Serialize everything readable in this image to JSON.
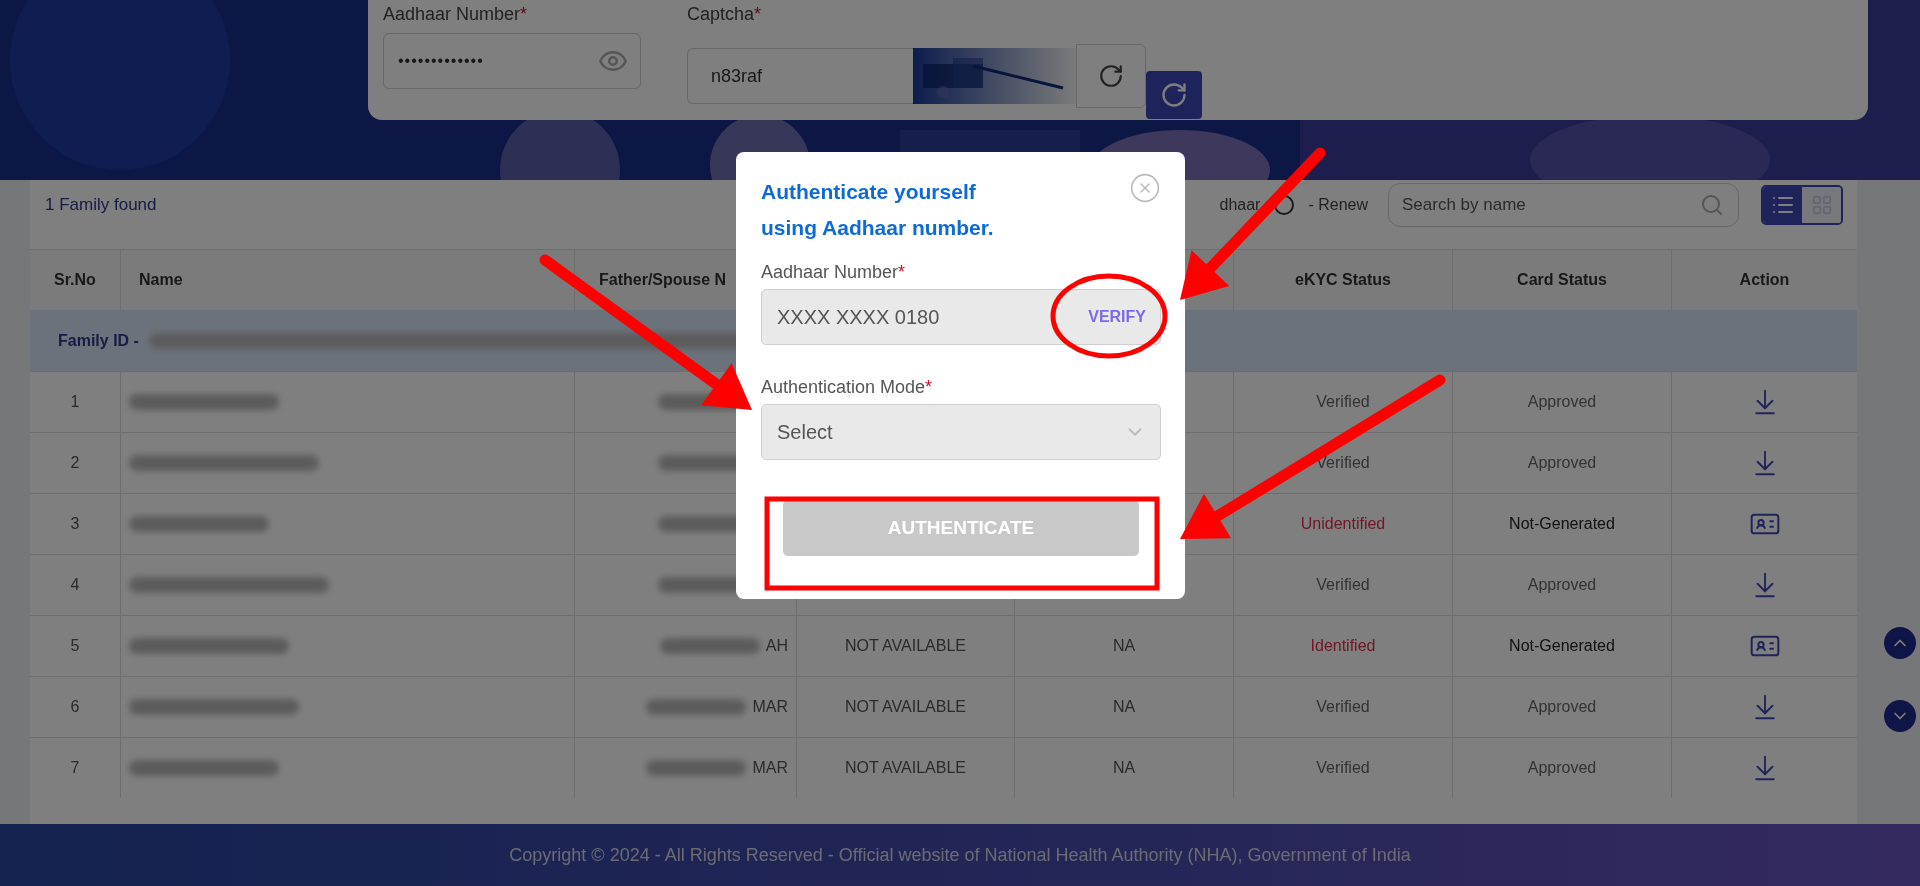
{
  "search_form": {
    "fields": [
      {
        "kind": "password",
        "label": "Aadhaar Number",
        "required_mark": "*",
        "value": "•••••••••••••"
      },
      {
        "kind": "captcha",
        "label": "Captcha",
        "required_mark": "*",
        "value": "n83raf"
      }
    ]
  },
  "results": {
    "summary": "1 Family found",
    "legend": [
      "dhaar",
      "- Renew"
    ],
    "search": {
      "placeholder": "Search by name"
    },
    "view_modes": [
      {
        "kind": "list",
        "selected": true
      },
      {
        "kind": "grid",
        "selected": false
      }
    ],
    "table": {
      "columns": [
        "Sr.No",
        "Name",
        "Father/Spouse N",
        "eKYC Status",
        "Card Status",
        "Action"
      ],
      "group": {
        "label": "Family ID -"
      },
      "rows": [
        {
          "sr": "1",
          "ekyc": {
            "text": "Verified",
            "verified": true
          },
          "card": {
            "text": "Approved",
            "generated": true
          },
          "action": {
            "kind": "download"
          }
        },
        {
          "sr": "2",
          "ekyc": {
            "text": "Verified",
            "verified": true
          },
          "card": {
            "text": "Approved",
            "generated": true
          },
          "action": {
            "kind": "download"
          }
        },
        {
          "sr": "3",
          "ekyc": {
            "text": "Unidentified",
            "verified": false
          },
          "card": {
            "text": "Not-Generated",
            "generated": false
          },
          "action": {
            "kind": "card"
          }
        },
        {
          "sr": "4",
          "ekyc": {
            "text": "Verified",
            "verified": true
          },
          "card": {
            "text": "Approved",
            "generated": true
          },
          "action": {
            "kind": "download"
          }
        },
        {
          "sr": "5",
          "father_fragment": "AH",
          "column_4": "NOT AVAILABLE",
          "column_5": "NA",
          "ekyc": {
            "text": "Identified",
            "verified": false
          },
          "card": {
            "text": "Not-Generated",
            "generated": false
          },
          "action": {
            "kind": "card"
          }
        },
        {
          "sr": "6",
          "father_fragment": "MAR",
          "column_4": "NOT AVAILABLE",
          "column_5": "NA",
          "ekyc": {
            "text": "Verified",
            "verified": true
          },
          "card": {
            "text": "Approved",
            "generated": true
          },
          "action": {
            "kind": "download"
          }
        },
        {
          "sr": "7",
          "father_fragment": "MAR",
          "column_4": "NOT AVAILABLE",
          "column_5": "NA",
          "ekyc": {
            "text": "Verified",
            "verified": true
          },
          "card": {
            "text": "Approved",
            "generated": true
          },
          "action": {
            "kind": "download"
          }
        }
      ]
    }
  },
  "footer": {
    "text": "Copyright © 2024 - All Rights Reserved - Official website of National Health Authority (NHA), Government of India"
  },
  "dialog": {
    "title": "Authenticate yourself using Aadhaar number.",
    "fields": [
      {
        "kind": "text",
        "label": "Aadhaar Number",
        "required_mark": "*",
        "value": "XXXX XXXX 0180",
        "action": "VERIFY"
      },
      {
        "kind": "select",
        "label": "Authentication Mode",
        "required_mark": "*",
        "value": "Select"
      }
    ],
    "submit": {
      "label": "AUTHENTICATE",
      "disabled": true
    }
  }
}
